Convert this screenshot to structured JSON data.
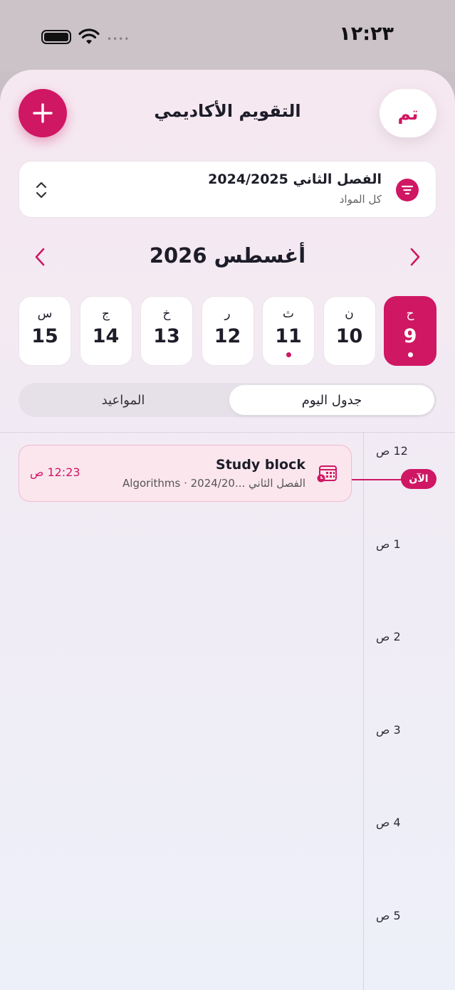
{
  "status": {
    "time": "١٢:٢٣",
    "signal_dots": "••••"
  },
  "header": {
    "title": "التقويم الأكاديمي",
    "done_label": "تم",
    "add_icon": "plus-icon"
  },
  "semester": {
    "title": "الفصل الثاني 2024/2025",
    "subtitle": "كل المواد"
  },
  "month": {
    "title": "أغسطس 2026"
  },
  "week": [
    {
      "name": "ح",
      "num": "9",
      "selected": true,
      "dot": true
    },
    {
      "name": "ن",
      "num": "10",
      "selected": false,
      "dot": false
    },
    {
      "name": "ث",
      "num": "11",
      "selected": false,
      "dot": true
    },
    {
      "name": "ر",
      "num": "12",
      "selected": false,
      "dot": false
    },
    {
      "name": "خ",
      "num": "13",
      "selected": false,
      "dot": false
    },
    {
      "name": "ج",
      "num": "14",
      "selected": false,
      "dot": false
    },
    {
      "name": "س",
      "num": "15",
      "selected": false,
      "dot": false
    }
  ],
  "tabs": {
    "active": "جدول اليوم",
    "inactive": "المواعيد"
  },
  "timeline": {
    "hours": [
      "12 ص",
      "1 ص",
      "2 ص",
      "3 ص",
      "4 ص",
      "5 ص"
    ],
    "now_label": "الآن"
  },
  "event": {
    "title": "Study block",
    "subtitle": "الفصل الثاني ...2024/20 · Algorithms",
    "time": "12:23 ص"
  },
  "colors": {
    "accent": "#cf1763"
  }
}
